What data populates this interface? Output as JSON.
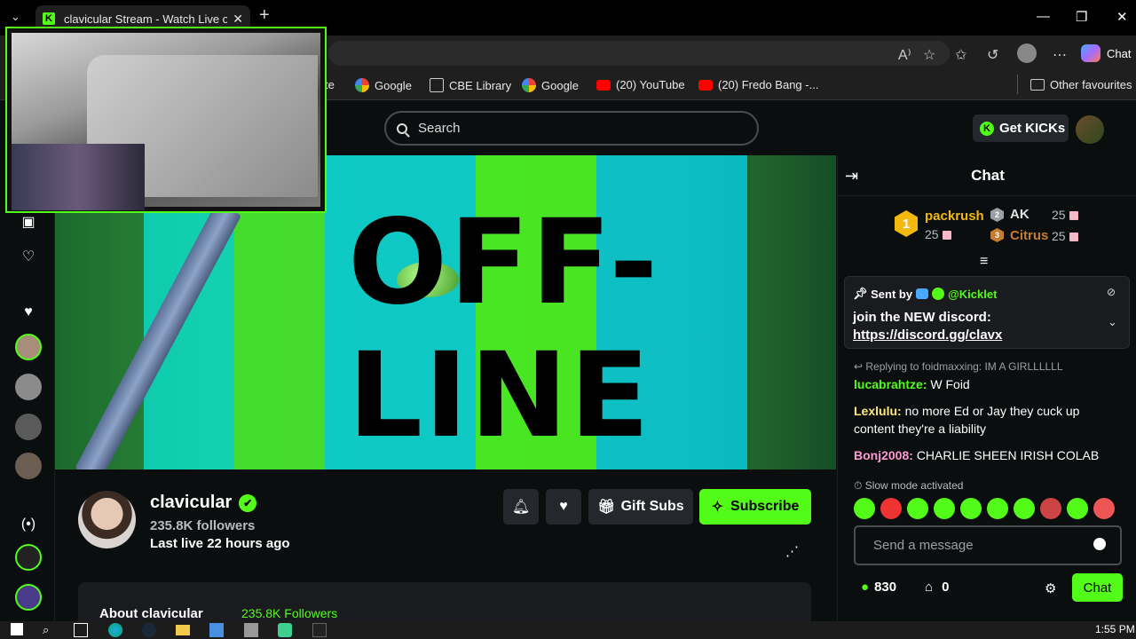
{
  "browser": {
    "tab_title": "clavicular Stream - Watch Live on K",
    "tab_close": "✕",
    "new_tab": "+",
    "window_controls": {
      "minimize": "—",
      "maximize": "❐",
      "close": "✕"
    },
    "read_aloud": "A⁾",
    "copilot_label": "Chat",
    "bookmarks": [
      {
        "label": "te",
        "icon": "page-icon"
      },
      {
        "label": "Google",
        "icon": "google-icon"
      },
      {
        "label": "CBE Library",
        "icon": "library-icon"
      },
      {
        "label": "Google",
        "icon": "google-icon"
      },
      {
        "label": "(20) YouTube",
        "icon": "youtube-icon"
      },
      {
        "label": "(20) Fredo Bang -...",
        "icon": "youtube-icon"
      }
    ],
    "other_favourites": "Other favourites"
  },
  "header": {
    "search_placeholder": "Search",
    "get_kicks": "Get KICKs",
    "kick_logo_letter": "K"
  },
  "player": {
    "offline_line1": "OFF-",
    "offline_line2": "LINE"
  },
  "channel": {
    "name": "clavicular",
    "verified_mark": "✔",
    "followers": "235.8K followers",
    "last_live": "Last live 22 hours ago",
    "gift_subs": "Gift Subs",
    "subscribe": "Subscribe",
    "about_title": "About clavicular",
    "about_followers": "235.8K Followers"
  },
  "chat": {
    "title": "Chat",
    "top_gifters": [
      {
        "rank": "1",
        "name": "packrush",
        "amount": "25",
        "color": "#f2b90c"
      },
      {
        "rank": "2",
        "name": "AK",
        "amount": "25",
        "color": "#e3e3e3"
      },
      {
        "rank": "3",
        "name": "Citrus",
        "amount": "25",
        "color": "#c77b30"
      }
    ],
    "pinned": {
      "sent_by": "Sent by",
      "author": "@Kicklet",
      "text": "join the NEW discord:",
      "link": "https://discord.gg/clavx"
    },
    "reply_context": "Replying to foidmaxxing: IM A GIRLLLLLL",
    "messages": [
      {
        "user": "lucabrahtze",
        "text": "W Foid",
        "color": "#53fc18"
      },
      {
        "user": "Lexlulu",
        "text": "no more Ed or Jay they cuck up content they're a liability",
        "color": "#ffe87a"
      },
      {
        "user": "Bonj2008",
        "text": "CHARLIE SHEEN IRISH COLAB",
        "color": "#ff9ad5"
      }
    ],
    "slow_mode": "Slow mode activated",
    "input_placeholder": "Send a message",
    "points": "830",
    "store_count": "0",
    "send_button": "Chat"
  },
  "taskbar": {
    "clock": "1:55 PM"
  },
  "colors": {
    "accent": "#53fc18",
    "background": "#0b0e0f",
    "panel": "#24272c"
  }
}
